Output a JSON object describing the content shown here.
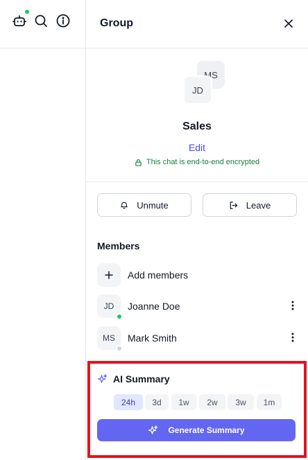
{
  "rail": {
    "bot_status_color": "#22c55e",
    "icons": [
      "robot-icon",
      "search-icon",
      "info-icon"
    ]
  },
  "panel": {
    "title": "Group",
    "close_icon": "close-icon"
  },
  "group": {
    "avatars": [
      "MS",
      "JD"
    ],
    "name": "Sales",
    "edit_label": "Edit",
    "encryption_text": "This chat is end-to-end encrypted"
  },
  "actions": {
    "unmute_label": "Unmute",
    "leave_label": "Leave"
  },
  "members": {
    "heading": "Members",
    "add_label": "Add members",
    "list": [
      {
        "initials": "JD",
        "name": "Joanne Doe",
        "status": "online",
        "status_color": "#22c55e"
      },
      {
        "initials": "MS",
        "name": "Mark Smith",
        "status": "offline",
        "status_color": "#d1d5db"
      }
    ]
  },
  "ai_summary": {
    "title": "AI Summary",
    "ranges": [
      "24h",
      "3d",
      "1w",
      "2w",
      "3w",
      "1m"
    ],
    "selected_range": "24h",
    "generate_label": "Generate Summary",
    "accent_color": "#6366f1",
    "highlight_color": "#e3141d"
  }
}
